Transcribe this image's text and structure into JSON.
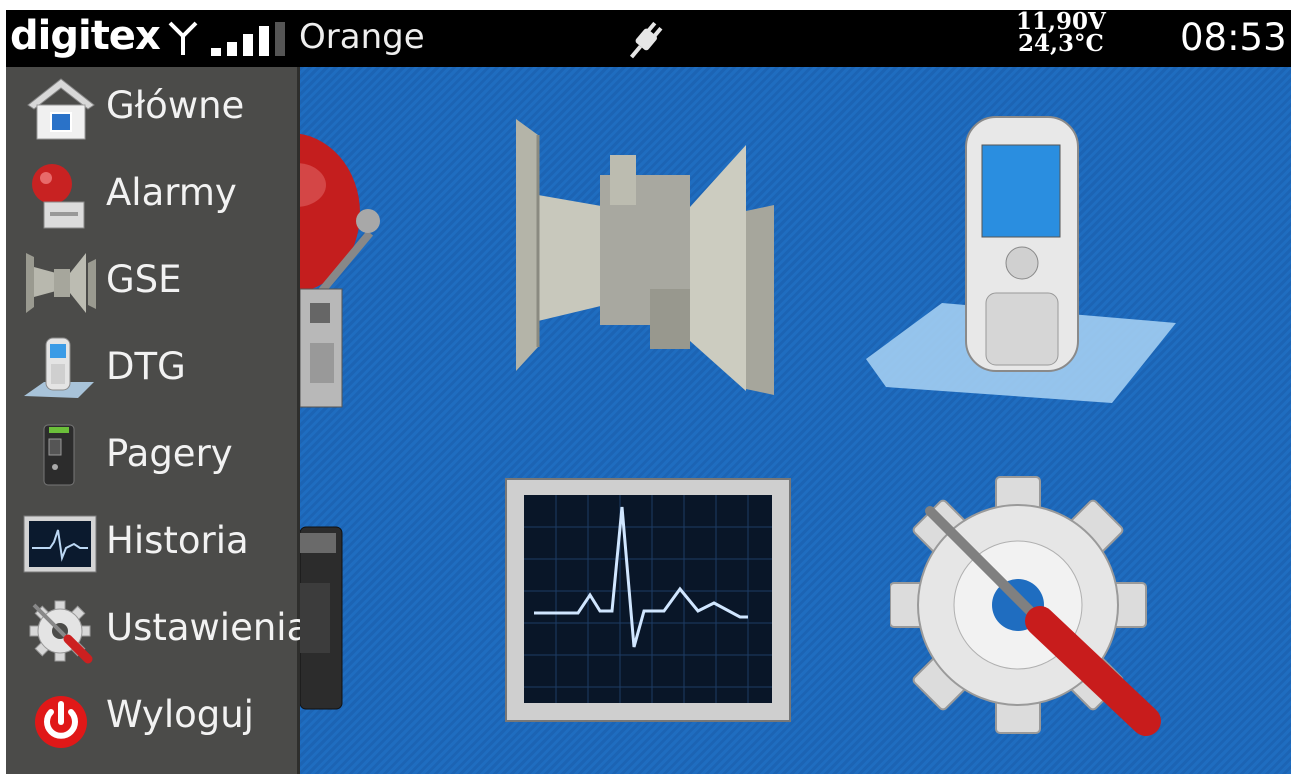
{
  "status_bar": {
    "brand": "digitex",
    "carrier": "Orange",
    "voltage": "11,90V",
    "temperature": "24,3°C",
    "clock": "08:53",
    "signal_bars": 4,
    "icons": [
      "antenna-icon",
      "signal-strength-icon",
      "power-plug-icon"
    ]
  },
  "sidebar": {
    "items": [
      {
        "label": "Główne",
        "icon": "home-icon"
      },
      {
        "label": "Alarmy",
        "icon": "alarm-bell-icon"
      },
      {
        "label": "GSE",
        "icon": "siren-horn-icon"
      },
      {
        "label": "DTG",
        "icon": "mobile-phone-icon"
      },
      {
        "label": "Pagery",
        "icon": "pager-icon"
      },
      {
        "label": "Historia",
        "icon": "ecg-monitor-icon"
      },
      {
        "label": "Ustawienia",
        "icon": "settings-gear-icon"
      },
      {
        "label": "Wyloguj",
        "icon": "power-button-icon"
      }
    ]
  },
  "desktop": {
    "tiles": [
      {
        "icon": "alarm-bell-icon"
      },
      {
        "icon": "siren-horn-icon"
      },
      {
        "icon": "mobile-phone-icon"
      },
      {
        "icon": "pager-icon"
      },
      {
        "icon": "ecg-monitor-icon"
      },
      {
        "icon": "settings-gear-icon"
      }
    ]
  },
  "colors": {
    "status_bar": "#000000",
    "sidebar": "#4b4b49",
    "desktop": "#1f6dc0",
    "text": "#f2f2f2"
  }
}
